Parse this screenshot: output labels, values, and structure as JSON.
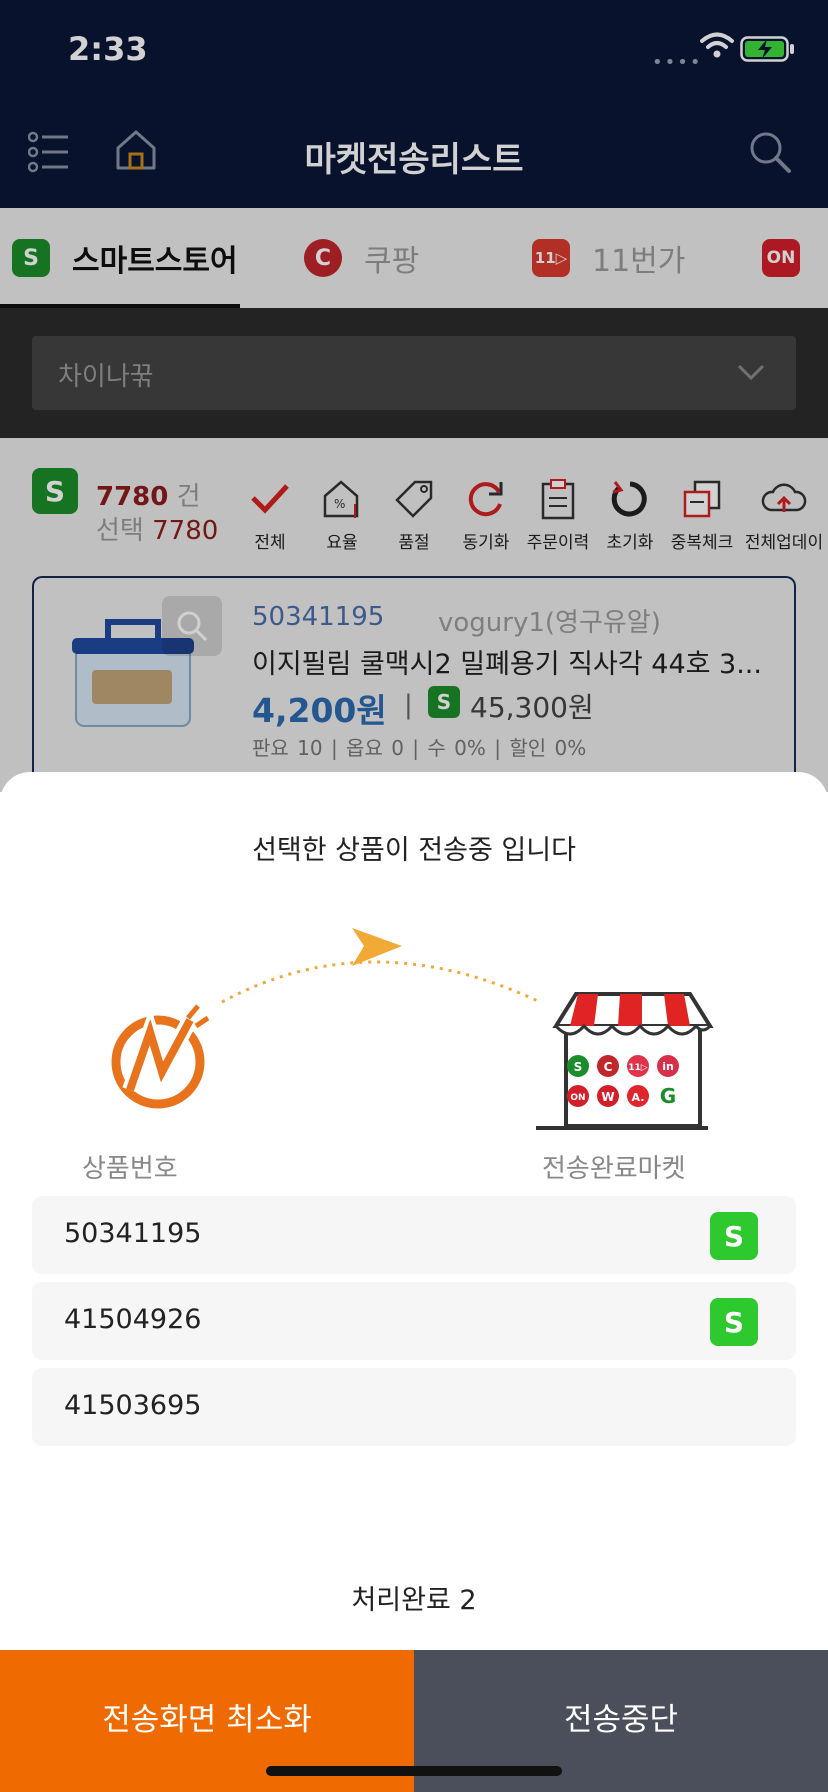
{
  "status_bar": {
    "time": "2:33",
    "signal": "••••"
  },
  "header": {
    "title": "마켓전송리스트"
  },
  "tabs": [
    {
      "icon": "S",
      "label": "스마트스토어",
      "color": "#1b8d2a",
      "active": true
    },
    {
      "icon": "C",
      "label": "쿠팡",
      "color": "#c0262c",
      "active": false
    },
    {
      "icon": "11▷",
      "label": "11번가",
      "color": "#d93a2f",
      "active": false
    },
    {
      "icon": "ON",
      "label": "",
      "color": "#d21f2a",
      "active": false
    }
  ],
  "filter": {
    "selected": "차이나꾺"
  },
  "counts": {
    "badge": "S",
    "total": "7780",
    "total_unit": "건",
    "selected_label": "선택",
    "selected": "7780"
  },
  "toolbar": [
    {
      "icon": "check-icon",
      "label": "전체"
    },
    {
      "icon": "house-rate-icon",
      "label": "요율"
    },
    {
      "icon": "tag-icon",
      "label": "품절"
    },
    {
      "icon": "sync-icon",
      "label": "동기화"
    },
    {
      "icon": "clipboard-icon",
      "label": "주문이력"
    },
    {
      "icon": "reset-icon",
      "label": "초기화"
    },
    {
      "icon": "duplicate-icon",
      "label": "중복체크"
    },
    {
      "icon": "cloud-upload-icon",
      "label": "전체업데이"
    }
  ],
  "product": {
    "id": "50341195",
    "seller": "vogury1(영구유알)",
    "name": "이지필림 쿨맥시2 밀폐용기 직사각 44호 3...",
    "price": "4,200원",
    "separator": "|",
    "market_badge": "S",
    "market_price": "45,300원",
    "meta": "판요 10  |  옵요 0  |  수 0%  |  할인 0%"
  },
  "sheet": {
    "title": "선택한 상품이 전송중 입니다",
    "illustration_markets": [
      "S",
      "C",
      "11▷",
      "in",
      "ON",
      "W",
      "A.",
      "G"
    ],
    "col_left": "상품번호",
    "col_right": "전송완료마켓",
    "rows": [
      {
        "id": "50341195",
        "market": "S"
      },
      {
        "id": "41504926",
        "market": "S"
      },
      {
        "id": "41503695",
        "market": ""
      }
    ],
    "progress": "처리완료 2"
  },
  "buttons": {
    "minimize": "전송화면 최소화",
    "stop": "전송중단"
  },
  "colors": {
    "navy": "#0b1738",
    "accent_orange": "#ef6a00",
    "smartstore_green": "#2ec92e",
    "stop_gray": "#4b4f5b"
  }
}
